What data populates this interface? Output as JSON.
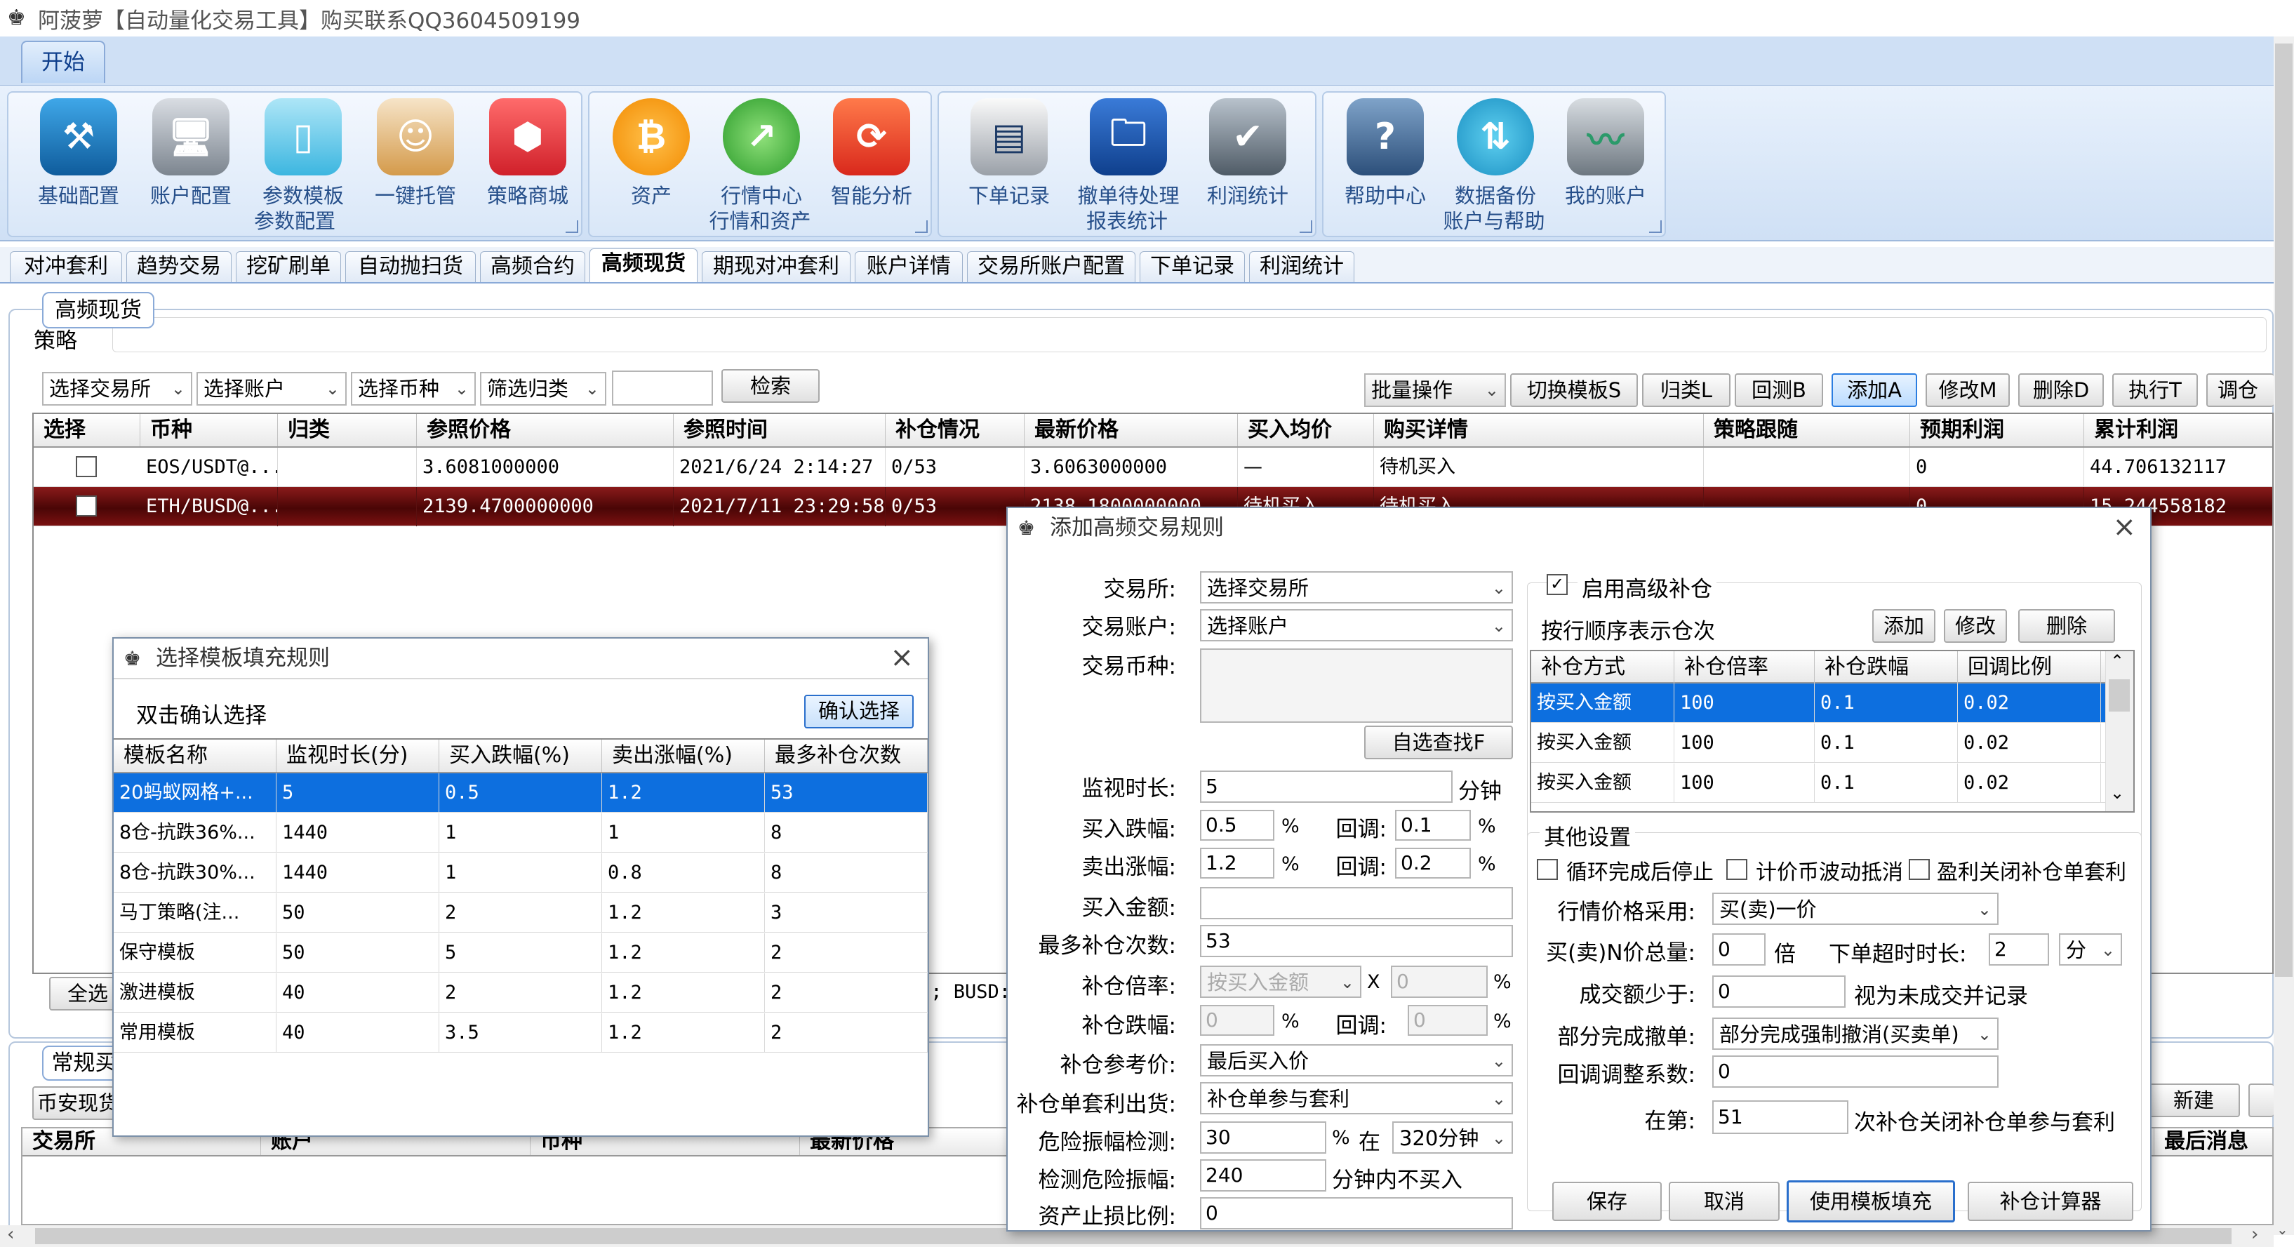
{
  "window_title": "阿菠萝【自动量化交易工具】购买联系QQ3604509199",
  "ribbon": {
    "tab": "开始",
    "groups": [
      {
        "title": "参数配置",
        "buttons": [
          "基础配置",
          "账户配置",
          "参数模板",
          "一键托管",
          "策略商城"
        ]
      },
      {
        "title": "行情和资产",
        "buttons": [
          "资产",
          "行情中心",
          "智能分析"
        ]
      },
      {
        "title": "报表统计",
        "buttons": [
          "下单记录",
          "撤单待处理",
          "利润统计"
        ]
      },
      {
        "title": "账户与帮助",
        "buttons": [
          "帮助中心",
          "数据备份",
          "我的账户"
        ]
      }
    ],
    "icons": {
      "基础配置": "toolbox-icon",
      "账户配置": "computer-icon",
      "参数模板": "tablet-icon",
      "一键托管": "robot-icon",
      "策略商城": "store-hex-icon",
      "资产": "bitcoin-icon",
      "行情中心": "chart-up-icon",
      "智能分析": "refresh-circle-icon",
      "下单记录": "register-icon",
      "撤单待处理": "folder-refresh-icon",
      "利润统计": "clipboard-check-icon",
      "帮助中心": "help-cube-icon",
      "数据备份": "backup-icon",
      "我的账户": "monitor-pulse-icon"
    }
  },
  "tabs": [
    "对冲套利",
    "趋势交易",
    "挖矿刷单",
    "自动抛扫货",
    "高频合约",
    "高频现货",
    "期现对冲套利",
    "账户详情",
    "交易所账户配置",
    "下单记录",
    "利润统计"
  ],
  "active_tab": "高频现货",
  "panel": {
    "title": "高频现货",
    "strategy_label": "策略",
    "filters": {
      "exchange": "选择交易所",
      "account": "选择账户",
      "coin": "选择币种",
      "category": "筛选归类",
      "search_value": "",
      "search_btn": "检索"
    },
    "actions": {
      "batch": "批量操作",
      "switch_template": "切换模板S",
      "categorize": "归类L",
      "backtest": "回测B",
      "add": "添加A",
      "modify": "修改M",
      "delete": "删除D",
      "execute": "执行T",
      "adjust": "调仓"
    },
    "table": {
      "headers": [
        "选择",
        "币种",
        "归类",
        "参照价格",
        "参照时间",
        "补仓情况",
        "最新价格",
        "买入均价",
        "购买详情",
        "策略跟随",
        "预期利润",
        "累计利润"
      ],
      "rows": [
        {
          "coin": "EOS/USDT@...",
          "category": "",
          "ref_price": "3.6081000000",
          "ref_time": "2021/6/24 2:14:27",
          "fill": "0/53",
          "latest": "3.6063000000",
          "avg": "—",
          "detail": "待机买入",
          "follow": "",
          "expected": "0",
          "total": "44.706132117"
        },
        {
          "coin": "ETH/BUSD@...",
          "category": "",
          "ref_price": "2139.4700000000",
          "ref_time": "2021/7/11 23:29:58",
          "fill": "0/53",
          "latest": "2138.1800000000",
          "avg": "待机买入",
          "detail": "待机买入",
          "follow": "",
          "expected": "0",
          "total": "15.244558182"
        }
      ]
    },
    "select_all": "全选",
    "status_fragment": "); BUSD:",
    "lower": {
      "title": "常规买",
      "exchange_btn": "币安现货",
      "new_btn": "新建",
      "headers": [
        "交易所",
        "账户",
        "币种",
        "最新价格",
        "最后消息"
      ]
    }
  },
  "template_dialog": {
    "title": "选择模板填充规则",
    "hint": "双击确认选择",
    "confirm": "确认选择",
    "headers": [
      "模板名称",
      "监视时长(分)",
      "买入跌幅(%)",
      "卖出涨幅(%)",
      "最多补仓次数"
    ],
    "rows": [
      [
        "20蚂蚁网格+...",
        "5",
        "0.5",
        "1.2",
        "53"
      ],
      [
        "8仓-抗跌36%...",
        "1440",
        "1",
        "1",
        "8"
      ],
      [
        "8仓-抗跌30%...",
        "1440",
        "1",
        "0.8",
        "8"
      ],
      [
        "马丁策略(注...",
        "50",
        "2",
        "1.2",
        "3"
      ],
      [
        "保守模板",
        "50",
        "5",
        "1.2",
        "2"
      ],
      [
        "激进模板",
        "40",
        "2",
        "1.2",
        "2"
      ],
      [
        "常用模板",
        "40",
        "3.5",
        "1.2",
        "2"
      ]
    ]
  },
  "add_dialog": {
    "title": "添加高频交易规则",
    "exchange_label": "交易所:",
    "exchange_value": "选择交易所",
    "account_label": "交易账户:",
    "account_value": "选择账户",
    "coin_label": "交易币种:",
    "pick_btn": "自选查找F",
    "monitor_label": "监视时长:",
    "monitor_value": "5",
    "monitor_unit": "分钟",
    "buy_drop_label": "买入跌幅:",
    "buy_drop_value": "0.5",
    "pct": "%",
    "rebound_label": "回调:",
    "buy_rebound": "0.1",
    "sell_rise_label": "卖出涨幅:",
    "sell_rise_value": "1.2",
    "sell_rebound": "0.2",
    "buy_amount_label": "买入金额:",
    "buy_amount_value": "",
    "max_fill_label": "最多补仓次数:",
    "max_fill_value": "53",
    "fill_rate_label": "补仓倍率:",
    "fill_rate_mode": "按买入金额",
    "x": "X",
    "fill_rate_value": "0",
    "fill_drop_label": "补仓跌幅:",
    "fill_drop_value": "0",
    "fill_rebound": "0",
    "fill_ref_label": "补仓参考价:",
    "fill_ref_value": "最后买入价",
    "fill_arb_label": "补仓单套利出货:",
    "fill_arb_value": "补仓单参与套利",
    "danger_label": "危险振幅检测:",
    "danger_value": "30",
    "in_label": "在",
    "danger_period": "320分钟",
    "detect_label": "检测危险振幅:",
    "detect_value": "240",
    "detect_unit": "分钟内不买入",
    "stoploss_label": "资产止损比例:",
    "stoploss_value": "0",
    "advanced_fill": "启用高级补仓",
    "order_hint": "按行顺序表示仓次",
    "grid_add": "添加",
    "grid_modify": "修改",
    "grid_delete": "删除",
    "fill_headers": [
      "补仓方式",
      "补仓倍率",
      "补仓跌幅",
      "回调比例"
    ],
    "fill_rows": [
      [
        "按买入金额",
        "100",
        "0.1",
        "0.02"
      ],
      [
        "按买入金额",
        "100",
        "0.1",
        "0.02"
      ],
      [
        "按买入金额",
        "100",
        "0.1",
        "0.02"
      ]
    ],
    "other_title": "其他设置",
    "chk_loop": "循环完成后停止",
    "chk_price": "计价币波动抵消",
    "chk_profit": "盈利关闭补仓单套利",
    "price_use_label": "行情价格采用:",
    "price_use_value": "买(卖)一价",
    "total_label": "买(卖)N价总量:",
    "total_value": "0",
    "times": "倍",
    "timeout_label": "下单超时时长:",
    "timeout_value": "2",
    "timeout_unit": "分",
    "min_deal_label": "成交额少于:",
    "min_deal_value": "0",
    "min_deal_hint": "视为未成交并记录",
    "partial_label": "部分完成撤单:",
    "partial_value": "部分完成强制撤消(买卖单)",
    "coef_label": "回调调整系数:",
    "coef_value": "0",
    "at_label": "在第:",
    "at_value": "51",
    "at_hint": "次补仓关闭补仓单参与套利",
    "save": "保存",
    "cancel": "取消",
    "use_template": "使用模板填充",
    "calculator": "补仓计算器"
  },
  "colors": {
    "ribbon_blue": "#cfe0f5",
    "selected_row": "#0d6fdf",
    "dark_row": "#6a0e0e"
  }
}
